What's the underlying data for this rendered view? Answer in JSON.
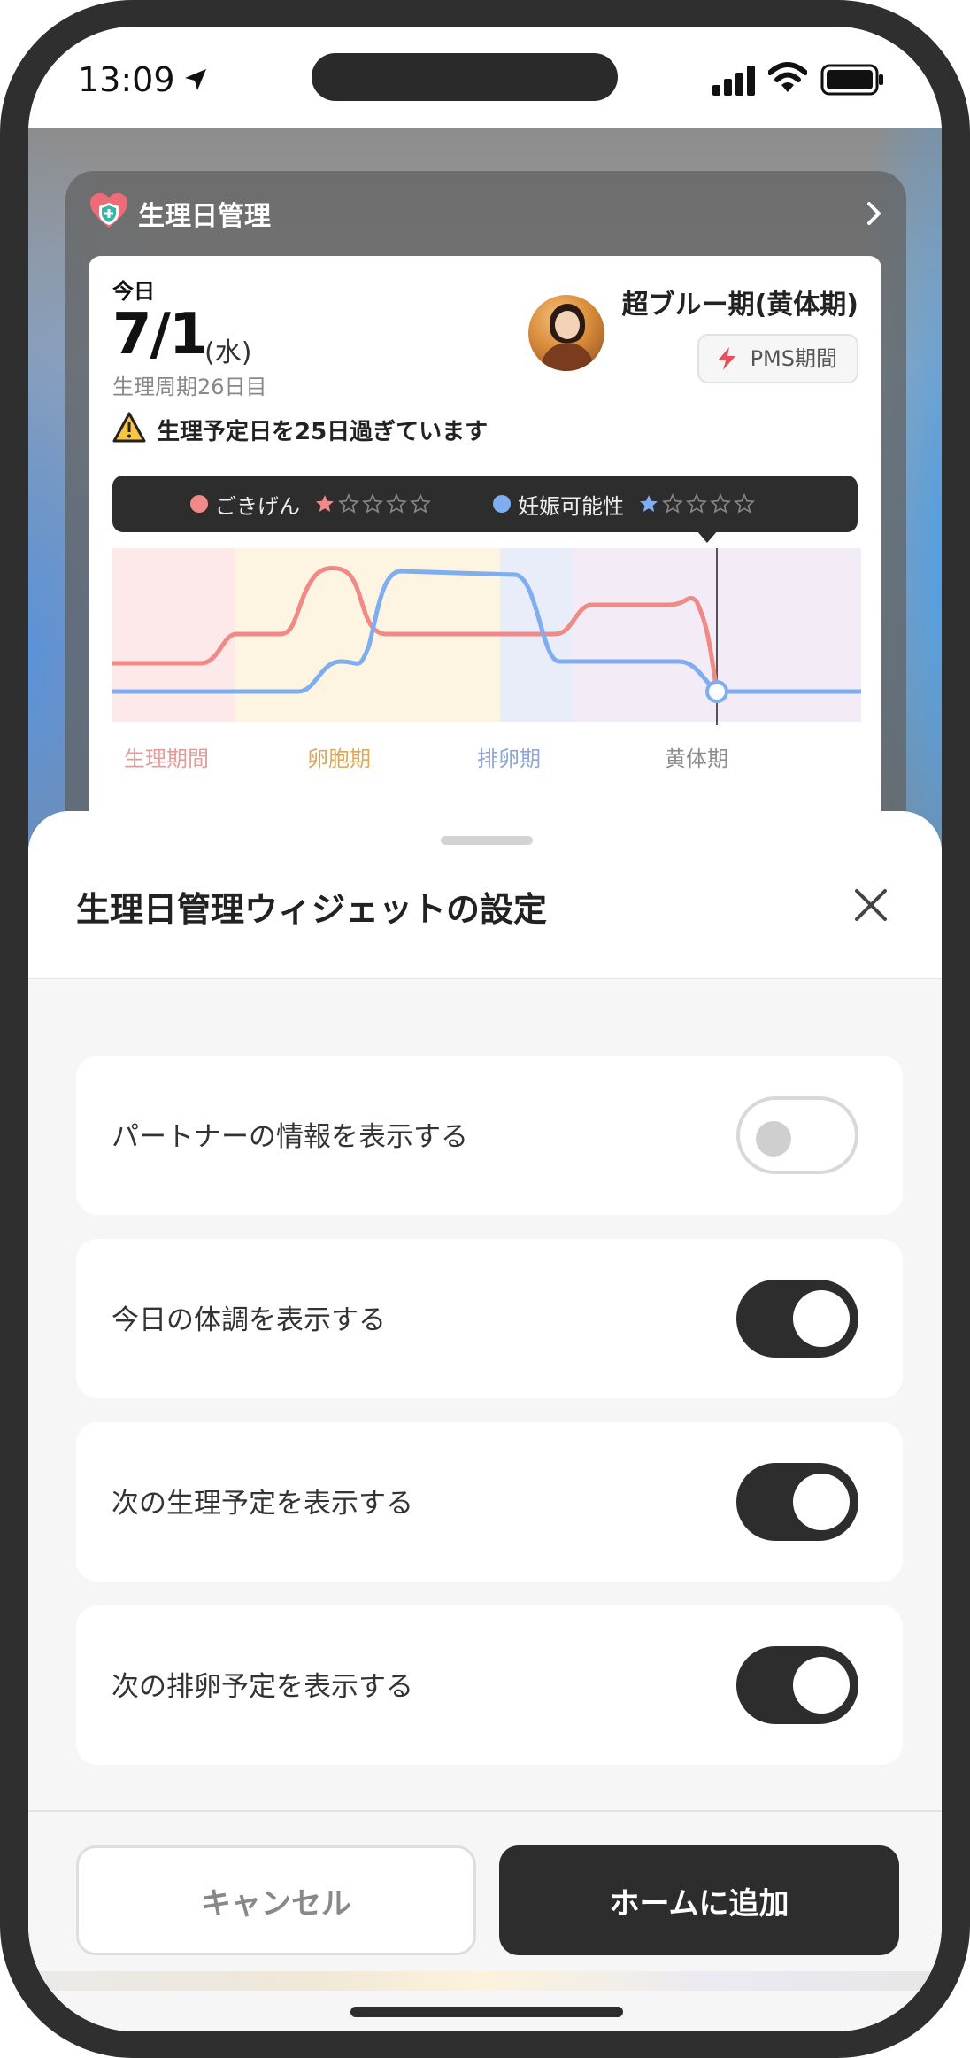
{
  "status_bar": {
    "time": "13:09"
  },
  "widget": {
    "title": "生理日管理",
    "today_label": "今日",
    "date": "7/1",
    "weekday": "(水)",
    "cycle_day": "生理周期26日目",
    "phase_name": "超ブルー期(黄体期)",
    "badge": "PMS期間",
    "warning": "生理予定日を25日過ぎています",
    "legend": [
      {
        "label": "ごきげん",
        "color": "#f08a86",
        "stars_filled": 1,
        "stars_total": 5
      },
      {
        "label": "妊娠可能性",
        "color": "#7faef0",
        "stars_filled": 1,
        "stars_total": 5
      }
    ],
    "phases": [
      {
        "label": "生理期間",
        "color": "#e39b9b",
        "bg": "#fde8ea"
      },
      {
        "label": "卵胞期",
        "color": "#d9a95e",
        "bg": "#fdf5e1"
      },
      {
        "label": "排卵期",
        "color": "#8ea6d6",
        "bg": "#e9edf9"
      },
      {
        "label": "黄体期",
        "color": "#8d8d8d",
        "bg": "#f3ecf7"
      }
    ]
  },
  "sheet": {
    "title": "生理日管理ウィジェットの設定",
    "settings": [
      {
        "label": "パートナーの情報を表示する",
        "enabled": false
      },
      {
        "label": "今日の体調を表示する",
        "enabled": true
      },
      {
        "label": "次の生理予定を表示する",
        "enabled": true
      },
      {
        "label": "次の排卵予定を表示する",
        "enabled": true
      }
    ],
    "cancel_label": "キャンセル",
    "add_label": "ホームに追加"
  }
}
